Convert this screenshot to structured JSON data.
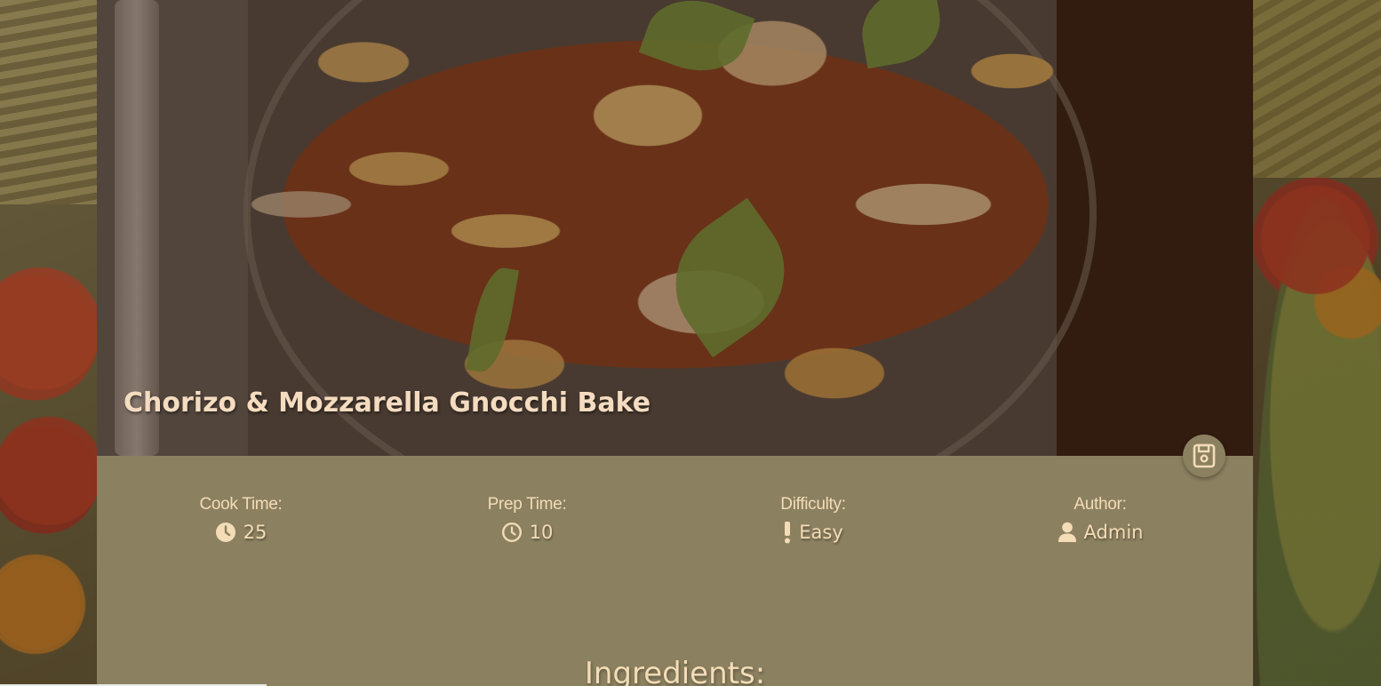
{
  "recipe": {
    "title": "Chorizo & Mozzarella Gnocchi Bake"
  },
  "actions": {
    "save_icon": "floppy-disk-icon"
  },
  "info": [
    {
      "label": "Cook Time:",
      "value": "25",
      "icon": "clock-solid-icon"
    },
    {
      "label": "Prep Time:",
      "value": "10",
      "icon": "clock-outline-icon"
    },
    {
      "label": "Difficulty:",
      "value": "Easy",
      "icon": "exclamation-icon"
    },
    {
      "label": "Author:",
      "value": "Admin",
      "icon": "user-icon"
    }
  ],
  "sections": {
    "ingredients_title": "Ingredients:"
  },
  "colors": {
    "panel": "#8b8060",
    "text_light": "#f3dcb6",
    "title_text": "#f5dcc0"
  }
}
